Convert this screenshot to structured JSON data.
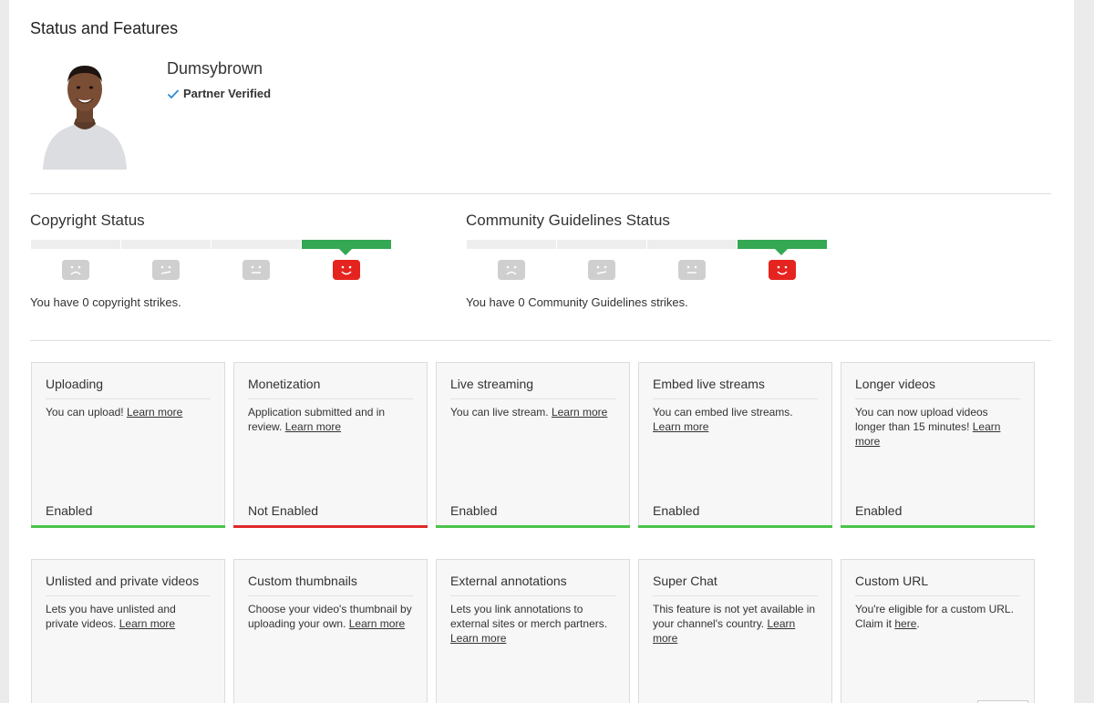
{
  "page_title": "Status and Features",
  "channel": {
    "name": "Dumsybrown",
    "verified_label": "Partner Verified"
  },
  "copyright": {
    "title": "Copyright Status",
    "strike_text": "You have 0 copyright strikes."
  },
  "community": {
    "title": "Community Guidelines Status",
    "strike_text": "You have 0 Community Guidelines strikes."
  },
  "learn_more_label": "Learn more",
  "colors": {
    "enabled": "#4cc34a",
    "not_enabled": "#e0282a",
    "active_segment": "#34a853",
    "good_face": "#e52420"
  },
  "features_row1": [
    {
      "title": "Uploading",
      "desc": "You can upload! ",
      "link": "Learn more",
      "status": "Enabled"
    },
    {
      "title": "Monetization",
      "desc": "Application submitted and in review. ",
      "link": "Learn more",
      "status": "Not Enabled"
    },
    {
      "title": "Live streaming",
      "desc": "You can live stream. ",
      "link": "Learn more",
      "status": "Enabled"
    },
    {
      "title": "Embed live streams",
      "desc": "You can embed live streams. ",
      "link": "Learn more",
      "status": "Enabled"
    },
    {
      "title": "Longer videos",
      "desc": "You can now upload videos longer than 15 minutes! ",
      "link": "Learn more",
      "status": "Enabled"
    }
  ],
  "features_row2": [
    {
      "title": "Unlisted and private videos",
      "desc": "Lets you have unlisted and private videos. ",
      "link": "Learn more"
    },
    {
      "title": "Custom thumbnails",
      "desc": "Choose your video's thumbnail by uploading your own. ",
      "link": "Learn more"
    },
    {
      "title": "External annotations",
      "desc": "Lets you link annotations to external sites or merch partners. ",
      "link": "Learn more"
    },
    {
      "title": "Super Chat",
      "desc": "This feature is not yet available in your channel's country. ",
      "link": "Learn more"
    },
    {
      "title": "Custom URL",
      "desc": "You're eligible for a custom URL. Claim it ",
      "link": "here",
      "suffix": "."
    }
  ]
}
